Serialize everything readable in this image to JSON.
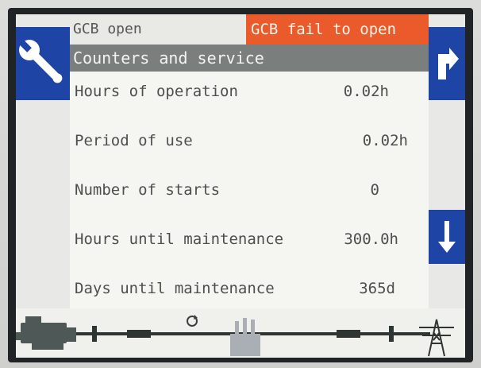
{
  "header": {
    "status_left": "GCB open",
    "alarm": "GCB fail to open"
  },
  "title": "Counters and service",
  "rows": [
    {
      "label": "Hours of operation",
      "value": "0.02h"
    },
    {
      "label": "Period of use",
      "value": "0.02h"
    },
    {
      "label": "Number of starts",
      "value": "0"
    },
    {
      "label": "Hours until maintenance",
      "value": "300.0h"
    },
    {
      "label": "Days until maintenance",
      "value": "365d"
    }
  ],
  "icons": {
    "left_button": "wrench-icon",
    "right_top_button": "arrow-return-icon",
    "right_bottom_button": "arrow-down-icon",
    "diagram_refresh": "refresh-icon",
    "generator": "generator-icon",
    "busbar": "busbar-line",
    "factory": "factory-icon",
    "grid": "power-tower-icon"
  },
  "colors": {
    "alarm": "#ea5a2a",
    "button": "#1e45a5",
    "title_bar": "#7a7f7d"
  }
}
